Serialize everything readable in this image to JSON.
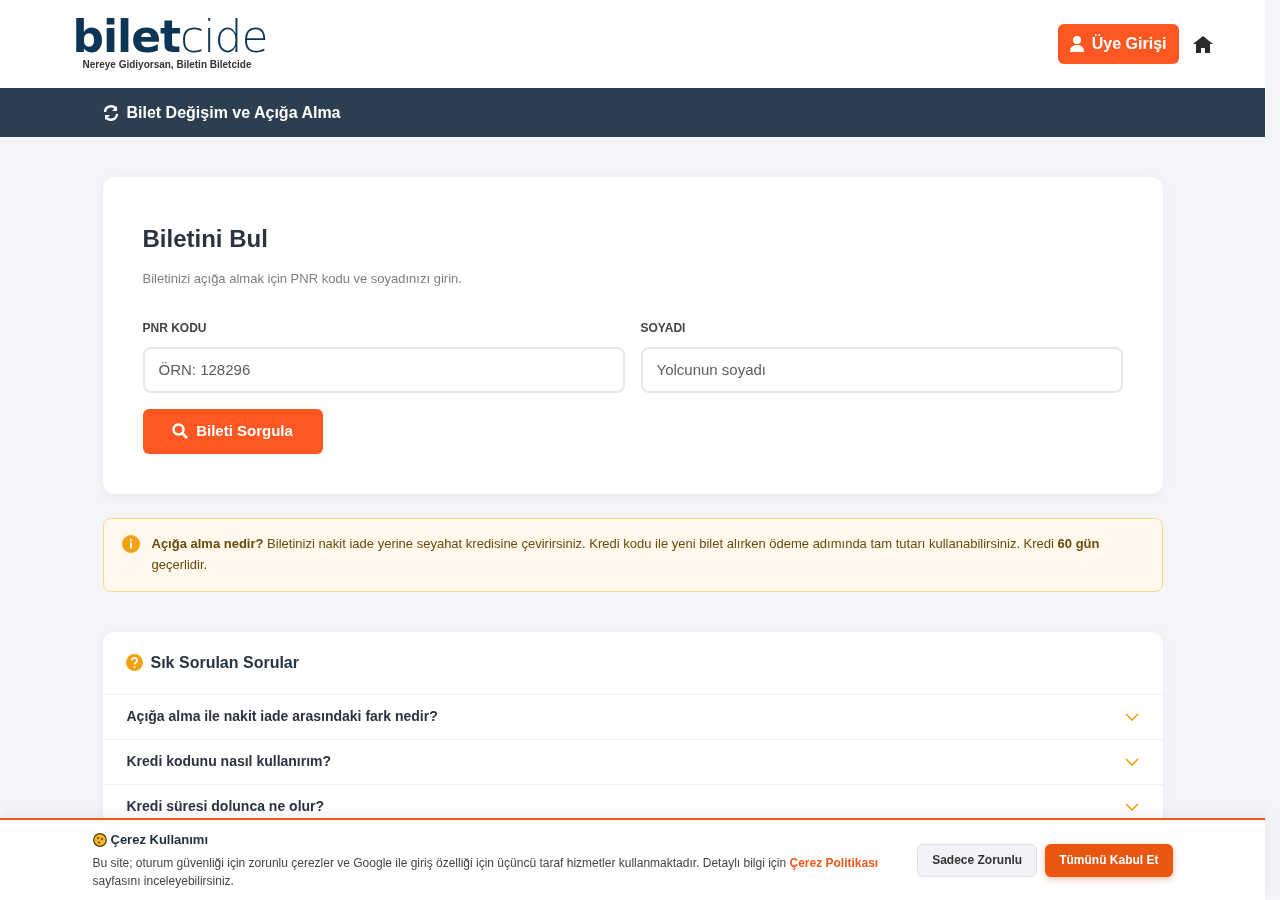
{
  "header": {
    "logo_bold": "bilet",
    "logo_light": "cide",
    "tagline": "Nereye Gidiyorsan, Biletin Biletcide",
    "login_button": "Üye Girişi"
  },
  "subnav": {
    "title": "Bilet Değişim ve Açığa Alma"
  },
  "search_card": {
    "title": "Biletini Bul",
    "subtitle": "Biletinizi açığa almak için PNR kodu ve soyadınızı girin.",
    "fields": [
      {
        "label": "PNR KODU",
        "placeholder": "ÖRN: 128296"
      },
      {
        "label": "SOYADI",
        "placeholder": "Yolcunun soyadı"
      }
    ],
    "button": "Bileti Sorgula"
  },
  "info": {
    "text": "**Açığa alma nedir?** Biletinizi nakit iade yerine seyahat kredisine çevirirsiniz. Kredi kodu ile yeni bilet alırken ödeme adımında tam tutarı kullanabilirsiniz. Kredi **60 gün** geçerlidir."
  },
  "faq": {
    "title": "Sık Sorulan Sorular",
    "items": [
      {
        "question": "Açığa alma ile nakit iade arasındaki fark nedir?",
        "expanded": false
      },
      {
        "question": "Kredi kodunu nasıl kullanırım?",
        "expanded": false
      },
      {
        "question": "Kredi süresi dolunca ne olur?",
        "expanded": false
      }
    ]
  },
  "cookie": {
    "title": "Çerez Kullanımı",
    "text_before": "Bu site; oturum güvenliği için zorunlu çerezler ve Google ile giriş özelliği için üçüncü taraf hizmetler kullanmaktadır. Detaylı bilgi için",
    "link": "Çerez Politikası",
    "text_after": "sayfasını inceleyebilirsiniz.",
    "buttons": [
      "Sadece Zorunlu",
      "Tümünü Kabul Et"
    ]
  }
}
